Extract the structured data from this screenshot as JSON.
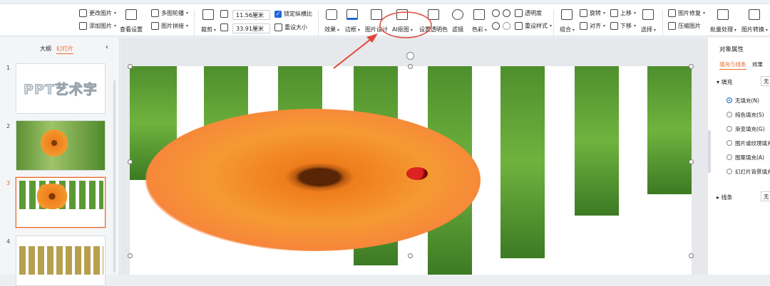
{
  "ribbon": {
    "change_picture": "更改图片",
    "view_settings": "查看设置",
    "add_picture": "添加图片",
    "multi_outline": "多图轮播",
    "picture_stitch": "图片拼接",
    "crop": "裁剪",
    "width": "11.56厘米",
    "height": "33.91厘米",
    "lock_ratio": "锁定纵横比",
    "reset_size": "重设大小",
    "effect": "效果",
    "border": "边框",
    "picture_design": "图片设计",
    "ai_cutout": "AI抠图",
    "set_transparent": "设置透明色",
    "filter": "滤镜",
    "color": "色彩",
    "transparency": "透明度",
    "reset_style": "重设样式",
    "combine": "组合",
    "rotate": "旋转",
    "align": "对齐",
    "move_up": "上移",
    "move_down": "下移",
    "select": "选择",
    "picture_repair": "图片修复",
    "compress": "压缩图片",
    "batch": "批量处理",
    "convert": "图片转换"
  },
  "left_panel": {
    "tab_outline": "大纲",
    "tab_slides": "幻灯片",
    "collapse_icon": "chevron-left-icon",
    "slides": [
      {
        "num": "1",
        "text": "PPT艺术字"
      },
      {
        "num": "2"
      },
      {
        "num": "3"
      },
      {
        "num": "4"
      }
    ]
  },
  "right_panel": {
    "title": "对象属性",
    "tab_fill": "填充与线条",
    "tab_effect": "效果",
    "section_fill": "填充",
    "fill_value": "无",
    "options": [
      "无填充(N)",
      "纯色填充(S)",
      "渐变填充(G)",
      "图片或纹理填充",
      "图案填充(A)",
      "幻灯片背景填充"
    ],
    "selected_option": 0,
    "section_line": "线条",
    "line_value": "无"
  },
  "annotation": {
    "color": "#e0483a"
  },
  "colors": {
    "accent": "#e86a2e",
    "blue": "#1f66d8"
  }
}
